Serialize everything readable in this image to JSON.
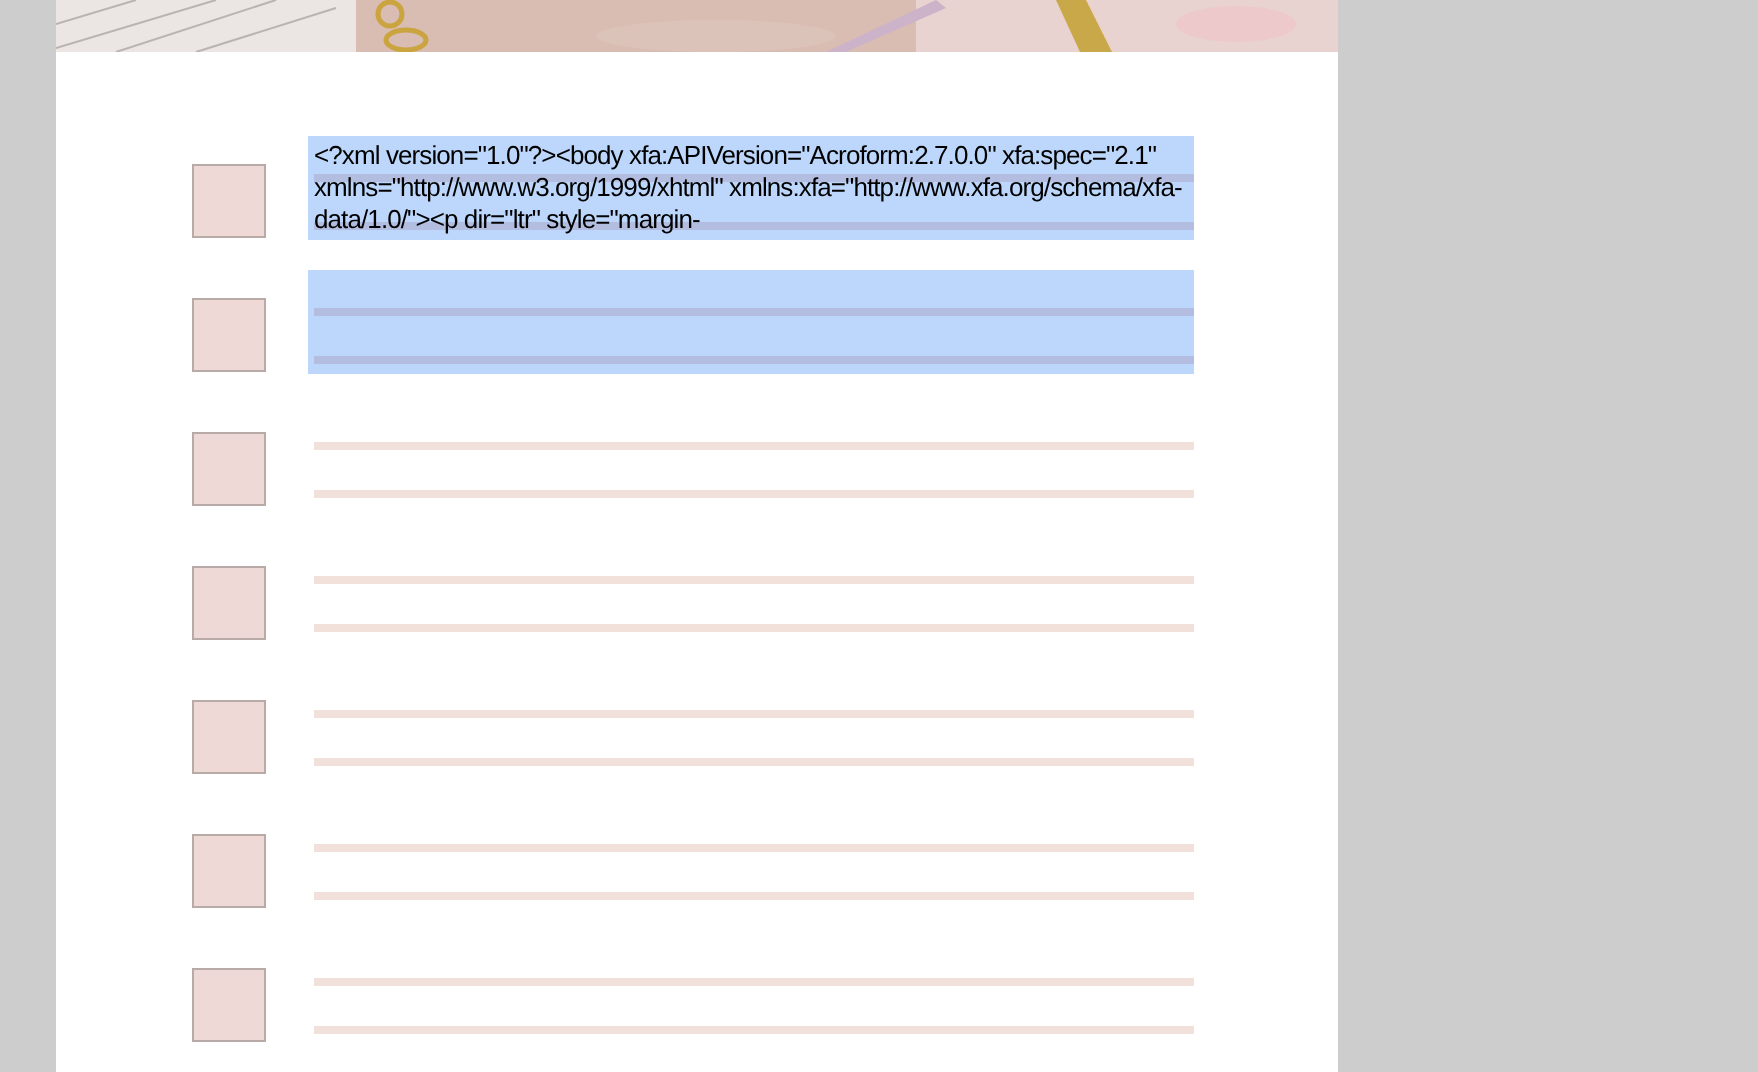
{
  "rows": [
    {
      "checked": false,
      "highlighted": true,
      "value": "<?xml version=\"1.0\"?><body xfa:APIVersion=\"Acroform:2.7.0.0\" xfa:spec=\"2.1\" xmlns=\"http://www.w3.org/1999/xhtml\" xmlns:xfa=\"http://www.xfa.org/schema/xfa-data/1.0/\"><p dir=\"ltr\" style=\"margin-"
    },
    {
      "checked": false,
      "highlighted": true
    },
    {
      "checked": false,
      "highlighted": false
    },
    {
      "checked": false,
      "highlighted": false
    },
    {
      "checked": false,
      "highlighted": false
    },
    {
      "checked": false,
      "highlighted": false
    },
    {
      "checked": false,
      "highlighted": false
    }
  ]
}
